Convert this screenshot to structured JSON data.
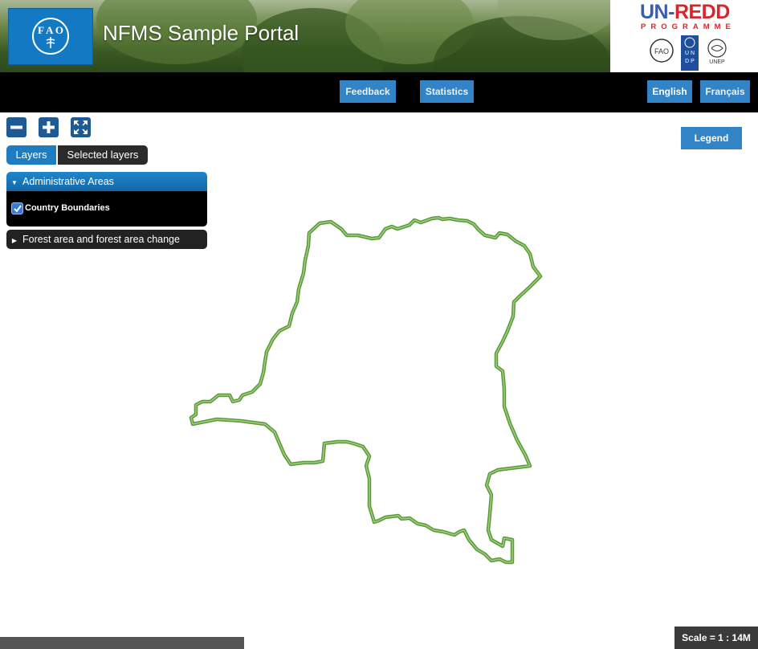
{
  "header": {
    "title": "NFMS Sample Portal",
    "logo_text": "FIAT PANIS",
    "unredd_title_un": "UN-",
    "unredd_title_redd": "REDD",
    "unredd_subtitle": "PROGRAMME",
    "partners": [
      "FAO",
      "UNDP",
      "UNEP"
    ]
  },
  "nav": {
    "feedback": "Feedback",
    "statistics": "Statistics",
    "english": "English",
    "francais": "Français"
  },
  "map_controls": [
    "zoom-out-icon",
    "zoom-in-icon",
    "zoom-extent-icon"
  ],
  "tabs": {
    "layers": "Layers",
    "selected": "Selected layers"
  },
  "layer_groups": [
    {
      "name": "Administrative Areas",
      "expanded": true,
      "layers": [
        {
          "name": "Country Boundaries",
          "checked": true
        }
      ]
    },
    {
      "name": "Forest area and forest area change",
      "expanded": false,
      "layers": []
    }
  ],
  "legend_label": "Legend",
  "scale_text": "Scale = 1 : 14M",
  "colors": {
    "accent": "#3284c7",
    "boundary": "#6aa84f",
    "nav_bg": "#000000"
  }
}
